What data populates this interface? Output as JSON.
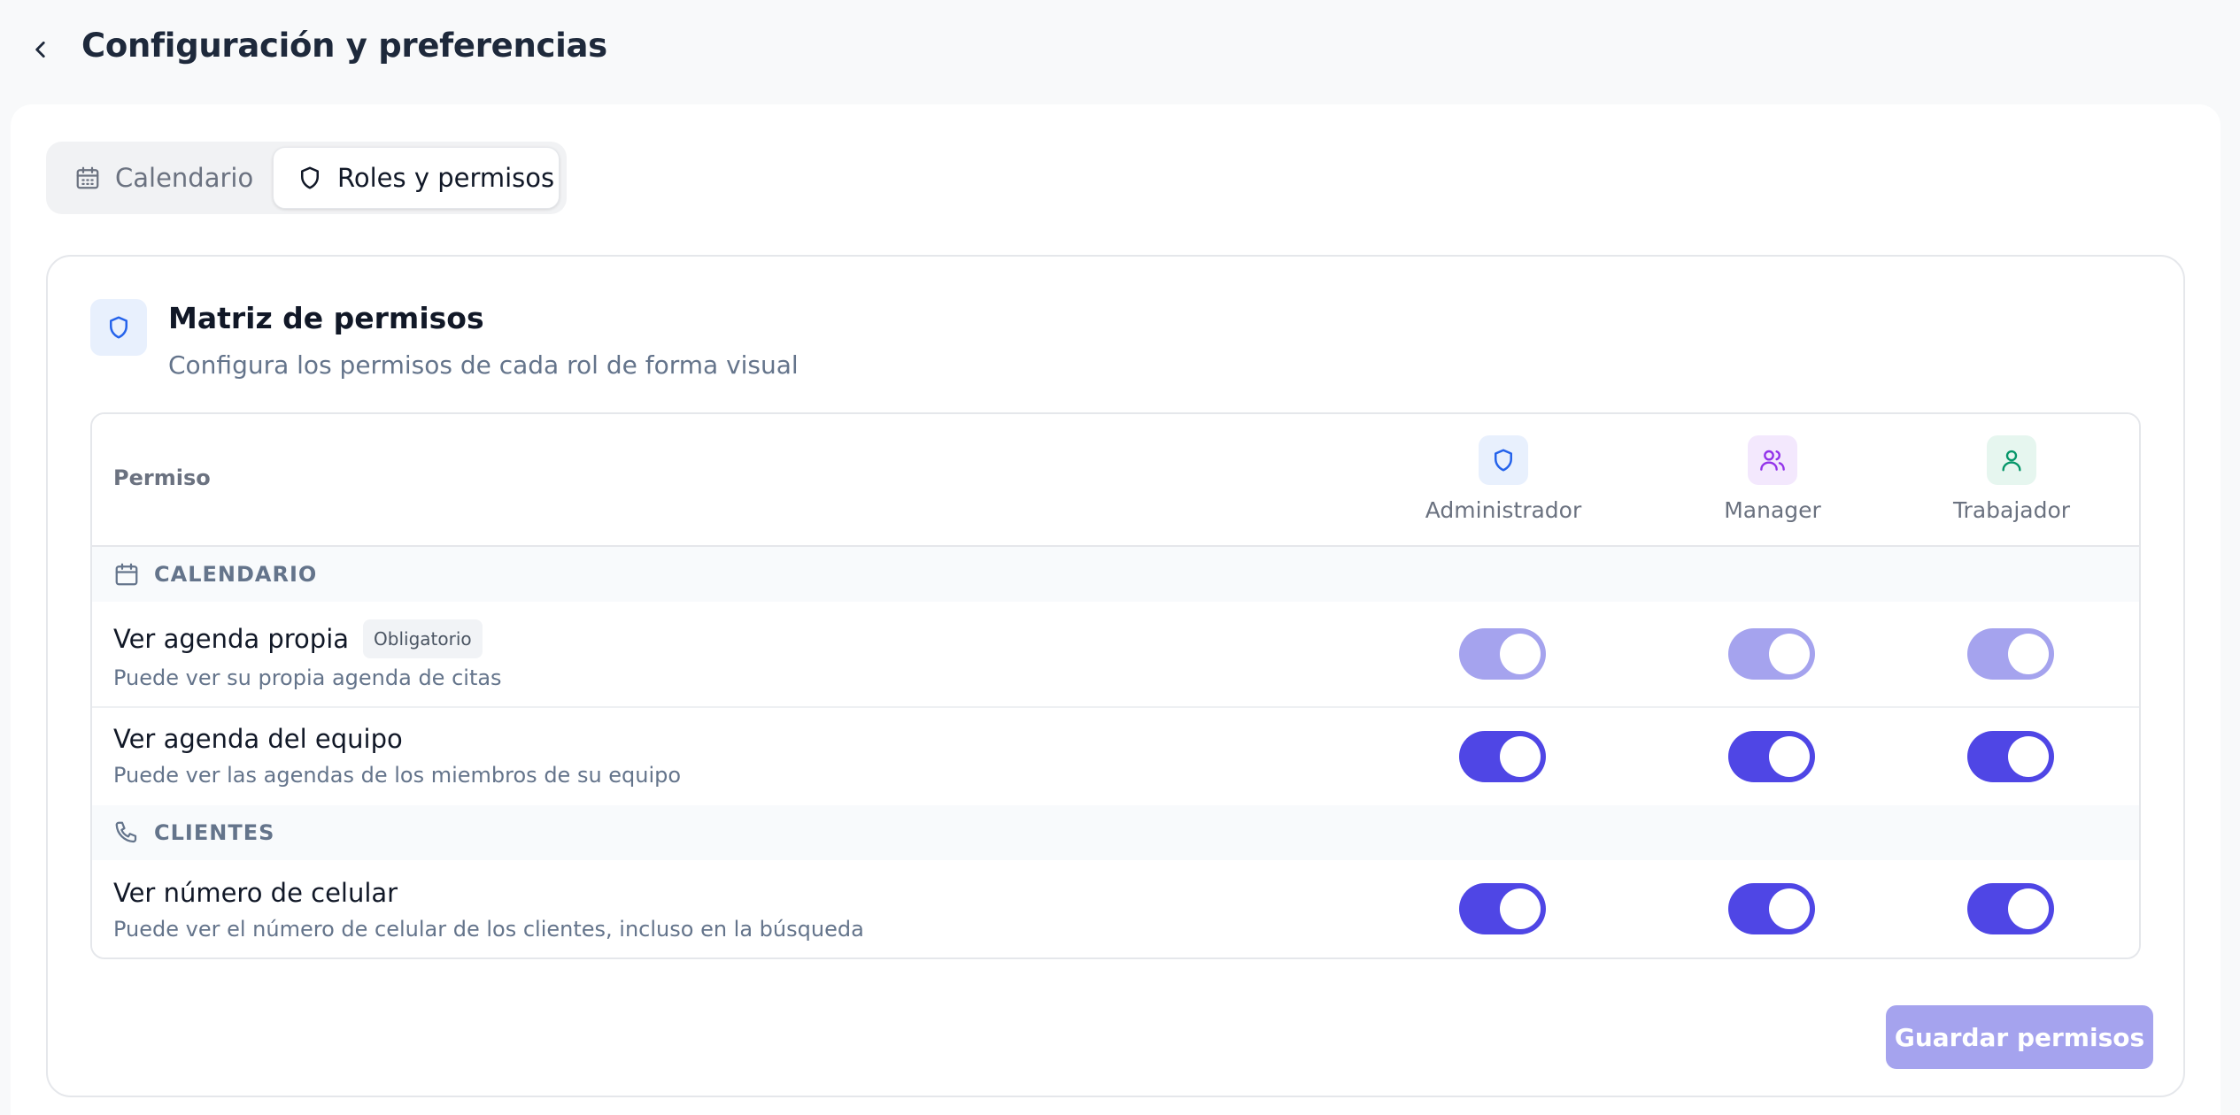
{
  "header": {
    "title": "Configuración y preferencias"
  },
  "tabs": [
    {
      "label": "Calendario",
      "icon": "calendar-icon",
      "active": false
    },
    {
      "label": "Roles y permisos",
      "icon": "shield-icon",
      "active": true
    }
  ],
  "card": {
    "title": "Matriz de permisos",
    "subtitle": "Configura los permisos de cada rol de forma visual"
  },
  "table": {
    "permission_header": "Permiso",
    "roles": [
      {
        "label": "Administrador",
        "icon": "shield-icon",
        "color": "#2563eb",
        "bg": "#e8f0fd"
      },
      {
        "label": "Manager",
        "icon": "users-icon",
        "color": "#9333ea",
        "bg": "#f3e8fd"
      },
      {
        "label": "Trabajador",
        "icon": "user-icon",
        "color": "#059669",
        "bg": "#e6f6ef"
      }
    ],
    "sections": [
      {
        "label": "CALENDARIO",
        "icon": "calendar-icon",
        "permissions": [
          {
            "title": "Ver agenda propia",
            "badge": "Obligatorio",
            "description": "Puede ver su propia agenda de citas",
            "values": [
              true,
              true,
              true
            ],
            "locked": true
          },
          {
            "title": "Ver agenda del equipo",
            "description": "Puede ver las agendas de los miembros de su equipo",
            "values": [
              true,
              true,
              true
            ],
            "locked": false
          }
        ]
      },
      {
        "label": "CLIENTES",
        "icon": "phone-icon",
        "permissions": [
          {
            "title": "Ver número de celular",
            "description": "Puede ver el número de celular de los clientes, incluso en la búsqueda",
            "values": [
              true,
              true,
              true
            ],
            "locked": false
          }
        ]
      }
    ]
  },
  "actions": {
    "save_label": "Guardar permisos"
  },
  "colors": {
    "accent": "#4f46e5",
    "accent_disabled": "#a5a3ee"
  }
}
